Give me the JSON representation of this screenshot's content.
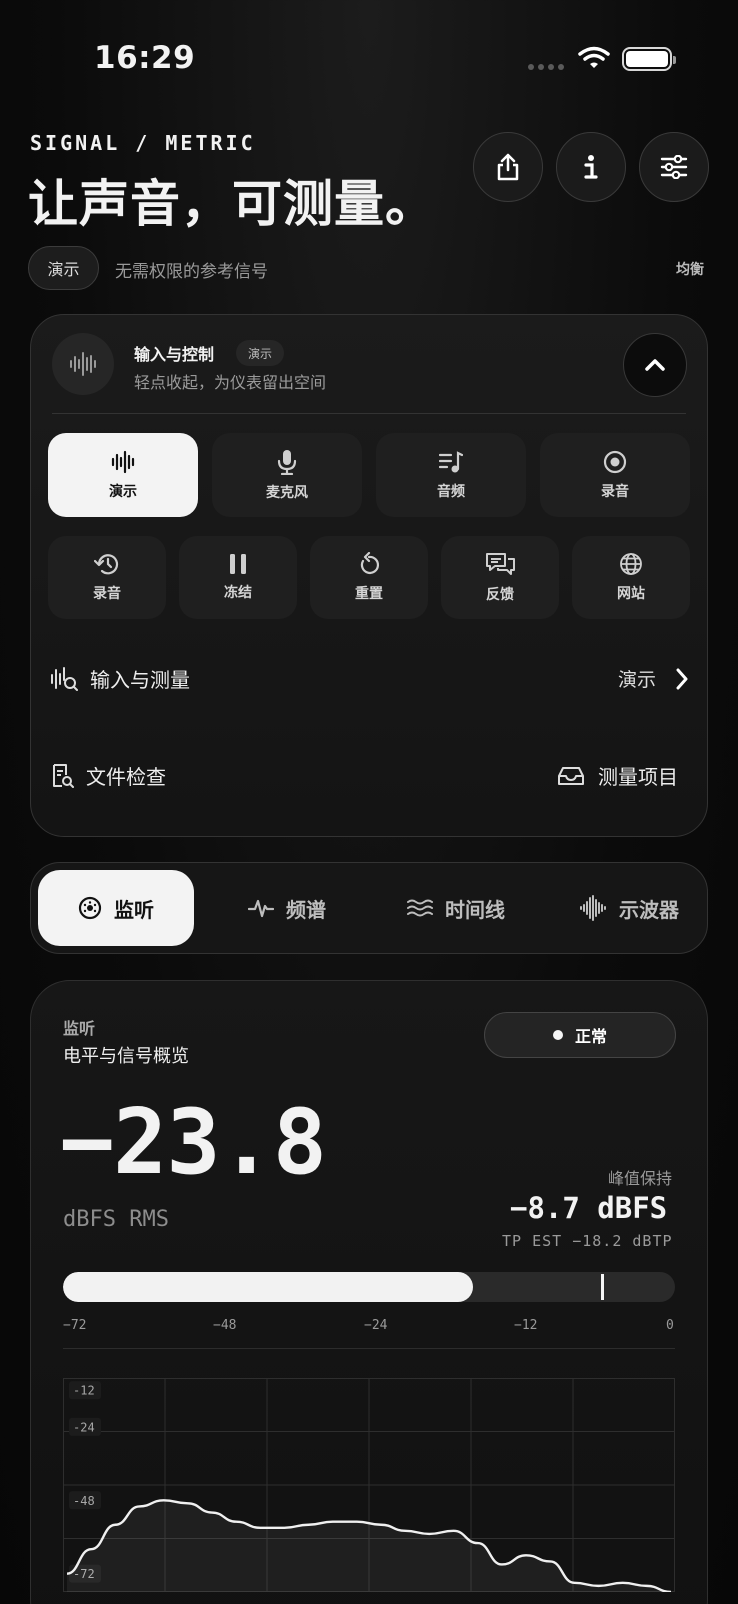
{
  "status_bar": {
    "time": "16:29"
  },
  "header": {
    "kicker": "SIGNAL / METRIC",
    "headline": "让声音，可测量。",
    "mode_pill": "演示",
    "mode_description": "无需权限的参考信号",
    "balance_label": "均衡"
  },
  "control_card": {
    "title": "输入与控制",
    "tag": "演示",
    "subtitle": "轻点收起，为仪表留出空间",
    "primary_tiles": [
      {
        "label": "演示",
        "icon": "waveform-icon",
        "active": true
      },
      {
        "label": "麦克风",
        "icon": "microphone-icon",
        "active": false
      },
      {
        "label": "音频",
        "icon": "music-list-icon",
        "active": false
      },
      {
        "label": "录音",
        "icon": "record-icon",
        "active": false
      }
    ],
    "secondary_tiles": [
      {
        "label": "录音",
        "icon": "history-icon"
      },
      {
        "label": "冻结",
        "icon": "pause-icon"
      },
      {
        "label": "重置",
        "icon": "reset-icon"
      },
      {
        "label": "反馈",
        "icon": "feedback-icon"
      },
      {
        "label": "网站",
        "icon": "globe-icon"
      }
    ],
    "input_row": {
      "label": "输入与测量",
      "value": "演示"
    },
    "files_row": {
      "label": "文件检查"
    },
    "projects_row": {
      "label": "测量项目"
    }
  },
  "tabs": [
    {
      "label": "监听",
      "icon": "dial-icon",
      "active": true
    },
    {
      "label": "频谱",
      "icon": "pulse-icon",
      "active": false
    },
    {
      "label": "时间线",
      "icon": "waves-icon",
      "active": false
    },
    {
      "label": "示波器",
      "icon": "oscilloscope-icon",
      "active": false
    }
  ],
  "monitor": {
    "label": "监听",
    "title": "电平与信号概览",
    "status": "正常",
    "rms_value": "−23.8",
    "rms_unit": "dBFS RMS",
    "peak_hold_label": "峰值保持",
    "peak_hold_value": "−8.7 dBFS",
    "true_peak": "TP EST −18.2 dBTP",
    "meter": {
      "min_db": -72,
      "max_db": 0,
      "level_db": -23.8,
      "peak_db": -8.7,
      "ticks": [
        "−72",
        "−48",
        "−24",
        "−12",
        "0"
      ]
    },
    "graph_labels": [
      "-12",
      "-24",
      "-48",
      "-72"
    ]
  },
  "chart_data": {
    "type": "line",
    "title": "",
    "xlabel": "",
    "ylabel": "",
    "ylim": [
      -78,
      -8
    ],
    "y_ticks": [
      -12,
      -24,
      -48,
      -72
    ],
    "grid": true,
    "series": [
      {
        "values": [
          -72,
          -64,
          -56,
          -50,
          -48,
          -49,
          -52,
          -55,
          -57,
          -57,
          -56,
          -55,
          -55,
          -56,
          -58,
          -59,
          -58,
          -62,
          -69,
          -66,
          -68,
          -75,
          -76,
          -75,
          -76,
          -78
        ]
      }
    ]
  },
  "colors": {
    "accent": "#f3f3f3",
    "background": "#0b0b0b",
    "card": "#171717"
  }
}
